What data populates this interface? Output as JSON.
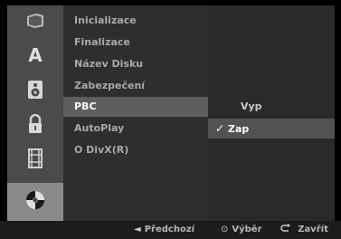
{
  "sidebar_icons": [
    "film-icon",
    "letter-a-icon",
    "speaker-icon",
    "padlock-icon",
    "film-strip-icon",
    "disc-icon"
  ],
  "menu": {
    "items": [
      {
        "label": "Inicializace"
      },
      {
        "label": "Finalizace"
      },
      {
        "label": "Název Disku"
      },
      {
        "label": "Zabezpečení"
      },
      {
        "label": "PBC"
      },
      {
        "label": "AutoPlay"
      },
      {
        "label": "O DivX(R)"
      }
    ],
    "selected": "PBC"
  },
  "submenu": {
    "options": [
      {
        "label": "Vyp"
      },
      {
        "label": "Zap",
        "checked": true
      }
    ]
  },
  "footer": {
    "prev_label": "Předchozí",
    "prev_icon": "◄",
    "select_label": "Výběr",
    "select_icon": "⊙",
    "close_label": "Zavřít",
    "close_icon": "return-icon"
  }
}
